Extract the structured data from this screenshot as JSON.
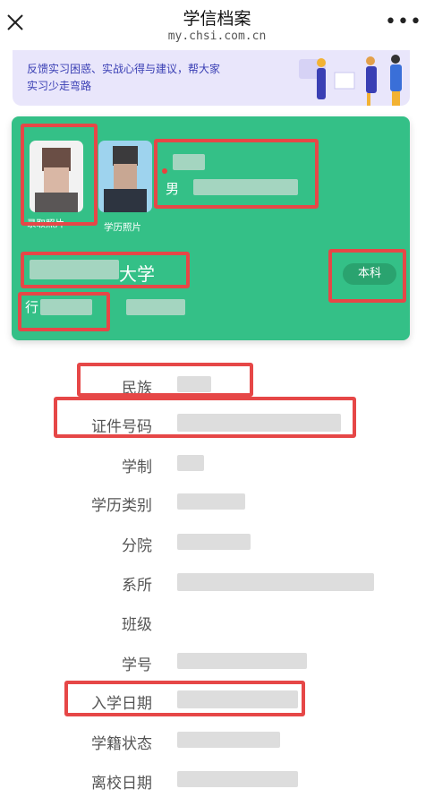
{
  "header": {
    "title": "学信档案",
    "subtitle": "my.chsi.com.cn",
    "close_icon": "close-icon",
    "more_icon": "more-icon"
  },
  "banner": {
    "line1": "反馈实习困惑、实战心得与建议，帮大家",
    "line2": "实习少走弯路"
  },
  "card": {
    "photo1_label": "录取照片",
    "photo2_label": "学历照片",
    "gender": "男",
    "university": "大学",
    "degree": "本科",
    "sub_left": "行",
    "sub_right": "",
    "accent_color": "#34c087"
  },
  "fields": [
    {
      "label": "民族"
    },
    {
      "label": "证件号码"
    },
    {
      "label": "学制"
    },
    {
      "label": "学历类别"
    },
    {
      "label": "分院"
    },
    {
      "label": "系所"
    },
    {
      "label": "班级"
    },
    {
      "label": "学号"
    },
    {
      "label": "入学日期"
    },
    {
      "label": "学籍状态"
    },
    {
      "label": "离校日期"
    }
  ],
  "highlight_color": "#e64747"
}
